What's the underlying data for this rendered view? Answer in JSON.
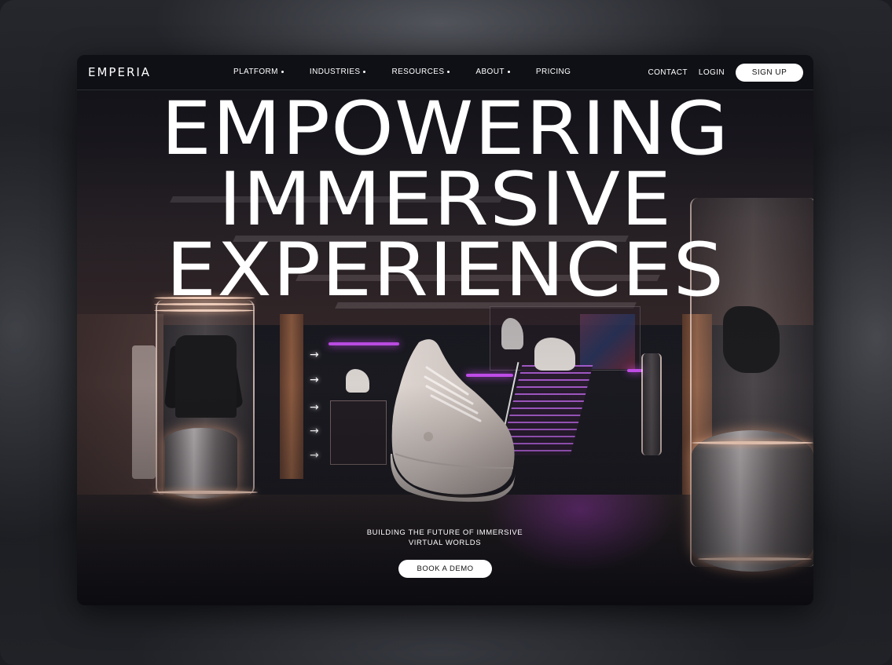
{
  "brand": {
    "logo_text": "EMPERIA"
  },
  "nav": {
    "links": [
      {
        "label": "PLATFORM",
        "has_dropdown": true
      },
      {
        "label": "INDUSTRIES",
        "has_dropdown": true
      },
      {
        "label": "RESOURCES",
        "has_dropdown": true
      },
      {
        "label": "ABOUT",
        "has_dropdown": true
      },
      {
        "label": "PRICING",
        "has_dropdown": false
      }
    ],
    "contact_label": "CONTACT",
    "login_label": "LOGIN",
    "signup_label": "SIGN UP"
  },
  "hero": {
    "headline_lines": [
      "EMPOWERING",
      "IMMERSIVE",
      "EXPERIENCES"
    ],
    "subtitle_line1": "BUILDING THE FUTURE OF IMMERSIVE",
    "subtitle_line2": "VIRTUAL WORLDS",
    "cta_label": "BOOK A DEMO"
  },
  "colors": {
    "accent_purple": "#c04de8",
    "warm_light": "#ffd9c4",
    "button_bg": "#ffffff",
    "card_bg": "#15161e"
  }
}
